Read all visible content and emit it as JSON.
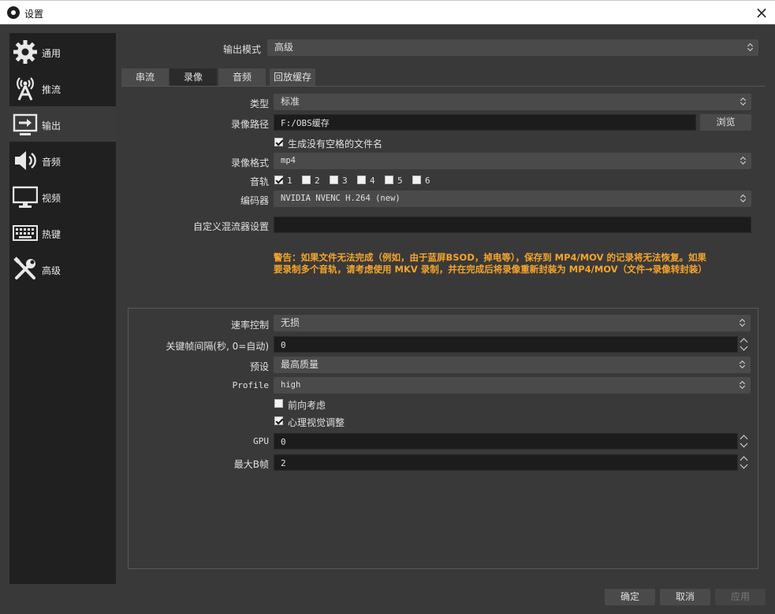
{
  "window": {
    "title": "设置",
    "close_glyph": "×"
  },
  "sidebar": {
    "items": [
      {
        "label": "通用",
        "icon": "gear-icon"
      },
      {
        "label": "推流",
        "icon": "antenna-icon"
      },
      {
        "label": "输出",
        "icon": "output-icon",
        "active": true
      },
      {
        "label": "音频",
        "icon": "speaker-icon"
      },
      {
        "label": "视频",
        "icon": "monitor-icon"
      },
      {
        "label": "热键",
        "icon": "keyboard-icon"
      },
      {
        "label": "高级",
        "icon": "tools-icon"
      }
    ]
  },
  "output_mode": {
    "label": "输出模式",
    "value": "高级"
  },
  "tabs": [
    {
      "label": "串流"
    },
    {
      "label": "录像",
      "active": true
    },
    {
      "label": "音频"
    },
    {
      "label": "回放缓存"
    }
  ],
  "recording": {
    "type_label": "类型",
    "type_value": "标准",
    "path_label": "录像路径",
    "path_value": "F:/OBS缓存",
    "browse_label": "浏览",
    "nospace_label": "生成没有空格的文件名",
    "nospace_checked": true,
    "format_label": "录像格式",
    "format_value": "mp4",
    "tracks_label": "音轨",
    "tracks": [
      {
        "num": "1",
        "checked": true
      },
      {
        "num": "2",
        "checked": false
      },
      {
        "num": "3",
        "checked": false
      },
      {
        "num": "4",
        "checked": false
      },
      {
        "num": "5",
        "checked": false
      },
      {
        "num": "6",
        "checked": false
      }
    ],
    "encoder_label": "编码器",
    "encoder_value": "NVIDIA NVENC H.264 (new)",
    "muxer_label": "自定义混流器设置",
    "muxer_value": "",
    "warning_line1": "警告：如果文件无法完成（例如，由于蓝屏BSOD，掉电等），保存到 MP4/MOV 的记录将无法恢复。如果",
    "warning_line2": "要录制多个音轨，请考虑使用 MKV 录制，并在完成后将录像重新封装为 MP4/MOV（文件→录像转封装）",
    "warning_color": "#f4a52c"
  },
  "encoder_settings": {
    "rate_label": "速率控制",
    "rate_value": "无损",
    "keyint_label": "关键帧间隔(秒, 0=自动)",
    "keyint_value": "0",
    "preset_label": "预设",
    "preset_value": "最高质量",
    "profile_label": "Profile",
    "profile_value": "high",
    "lookahead_label": "前向考虑",
    "lookahead_checked": false,
    "psycho_label": "心理视觉调整",
    "psycho_checked": true,
    "gpu_label": "GPU",
    "gpu_value": "0",
    "bframes_label": "最大B帧",
    "bframes_value": "2"
  },
  "footer": {
    "ok_label": "确定",
    "cancel_label": "取消",
    "apply_label": "应用"
  }
}
